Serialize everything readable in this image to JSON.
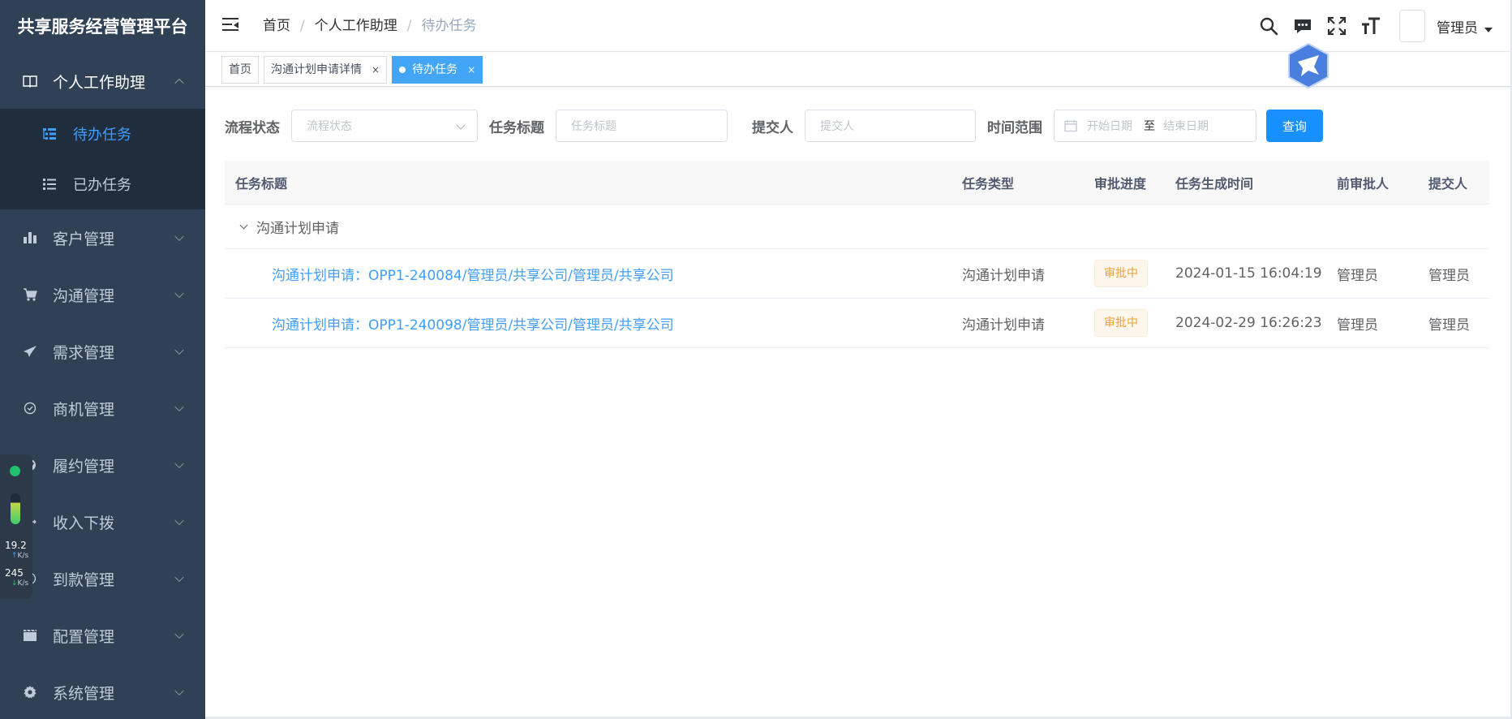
{
  "app": {
    "title": "共享服务经营管理平台"
  },
  "sidebar": {
    "open_menu": {
      "label": "个人工作助理",
      "icon": "book-icon"
    },
    "sub_items": [
      {
        "label": "待办任务",
        "icon": "list-tree-icon",
        "active": true
      },
      {
        "label": "已办任务",
        "icon": "list-icon",
        "active": false
      }
    ],
    "items": [
      {
        "label": "客户管理",
        "icon": "bar-chart-icon"
      },
      {
        "label": "沟通管理",
        "icon": "cart-icon"
      },
      {
        "label": "需求管理",
        "icon": "paper-plane-icon"
      },
      {
        "label": "商机管理",
        "icon": "check-circle-icon"
      },
      {
        "label": "履约管理",
        "icon": "globe-icon"
      },
      {
        "label": "收入下拨",
        "icon": "move-icon"
      },
      {
        "label": "到款管理",
        "icon": "money-icon"
      },
      {
        "label": "配置管理",
        "icon": "clapper-icon"
      },
      {
        "label": "系统管理",
        "icon": "gear-icon"
      }
    ]
  },
  "net_widget": {
    "up_value": "19.2",
    "up_unit": "K/s",
    "down_value": "245",
    "down_unit": "K/s"
  },
  "header": {
    "breadcrumb": [
      "首页",
      "个人工作助理",
      "待办任务"
    ],
    "separator": "/",
    "user_name": "管理员"
  },
  "tags": [
    {
      "label": "首页",
      "closable": false,
      "active": false
    },
    {
      "label": "沟通计划申请详情",
      "closable": true,
      "active": false
    },
    {
      "label": "待办任务",
      "closable": true,
      "active": true
    }
  ],
  "tag_close": "×",
  "search": {
    "status_label": "流程状态",
    "status_placeholder": "流程状态",
    "title_label": "任务标题",
    "title_placeholder": "任务标题",
    "submitter_label": "提交人",
    "submitter_placeholder": "提交人",
    "range_label": "时间范围",
    "start_placeholder": "开始日期",
    "range_sep": "至",
    "end_placeholder": "结束日期",
    "query_button": "查询"
  },
  "table": {
    "columns": [
      "任务标题",
      "任务类型",
      "审批进度",
      "任务生成时间",
      "前审批人",
      "提交人"
    ],
    "group_label": "沟通计划申请",
    "rows": [
      {
        "title": "沟通计划申请：OPP1-240084/管理员/共享公司/管理员/共享公司",
        "type": "沟通计划申请",
        "progress": "审批中",
        "created": "2024-01-15 16:04:19",
        "prev_approver": "管理员",
        "submitter": "管理员"
      },
      {
        "title": "沟通计划申请：OPP1-240098/管理员/共享公司/管理员/共享公司",
        "type": "沟通计划申请",
        "progress": "审批中",
        "created": "2024-02-29 16:26:23",
        "prev_approver": "管理员",
        "submitter": "管理员"
      }
    ]
  },
  "colors": {
    "sidebar_bg": "#304156",
    "submenu_bg": "#1f2d3d",
    "accent": "#409eff",
    "status_warning": "#e6a23c"
  }
}
